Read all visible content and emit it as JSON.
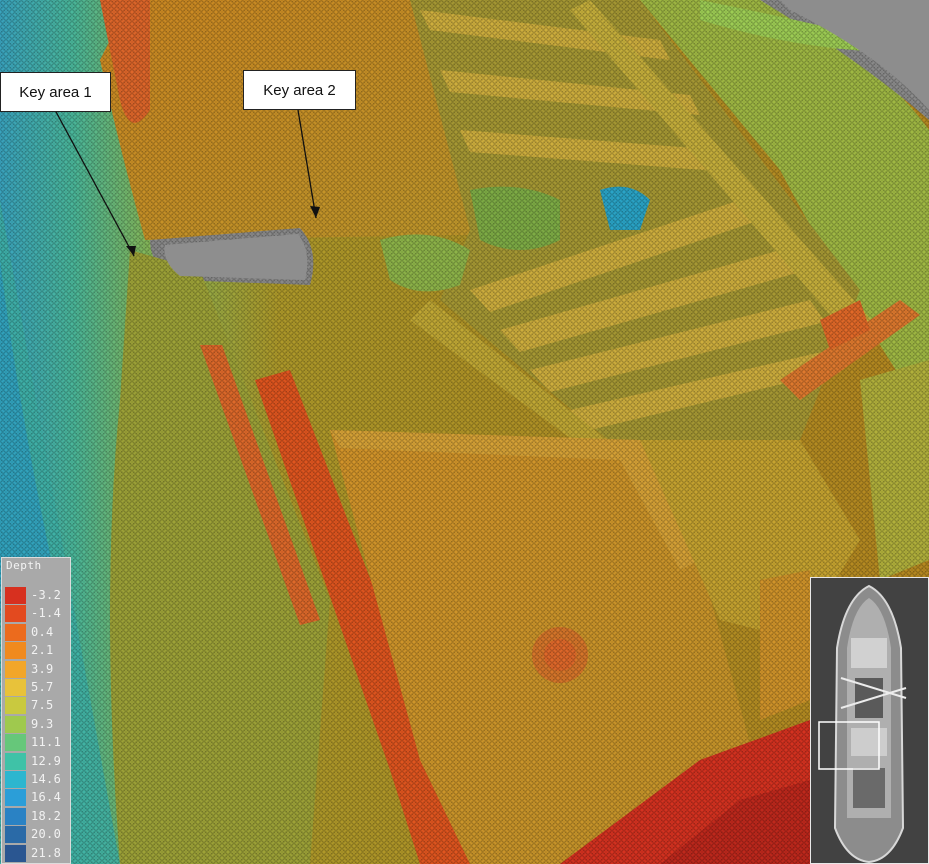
{
  "callouts": [
    {
      "label": "Key area 1"
    },
    {
      "label": "Key area 2"
    }
  ],
  "legend": {
    "title": "Depth",
    "items": [
      {
        "value": "-3.2",
        "color": "#d7301f"
      },
      {
        "value": "-1.4",
        "color": "#e34a1f"
      },
      {
        "value": "0.4",
        "color": "#ec6b1d"
      },
      {
        "value": "2.1",
        "color": "#f08a1e"
      },
      {
        "value": "3.9",
        "color": "#f2a629"
      },
      {
        "value": "5.7",
        "color": "#e8c23a"
      },
      {
        "value": "7.5",
        "color": "#c9c93f"
      },
      {
        "value": "9.3",
        "color": "#9fc94e"
      },
      {
        "value": "11.1",
        "color": "#66c77a"
      },
      {
        "value": "12.9",
        "color": "#3fc2a7"
      },
      {
        "value": "14.6",
        "color": "#2cb6cf"
      },
      {
        "value": "16.4",
        "color": "#2b9ed8"
      },
      {
        "value": "18.2",
        "color": "#2a82c4"
      },
      {
        "value": "20.0",
        "color": "#2a6aa7"
      },
      {
        "value": "21.8",
        "color": "#2a5691"
      }
    ]
  }
}
